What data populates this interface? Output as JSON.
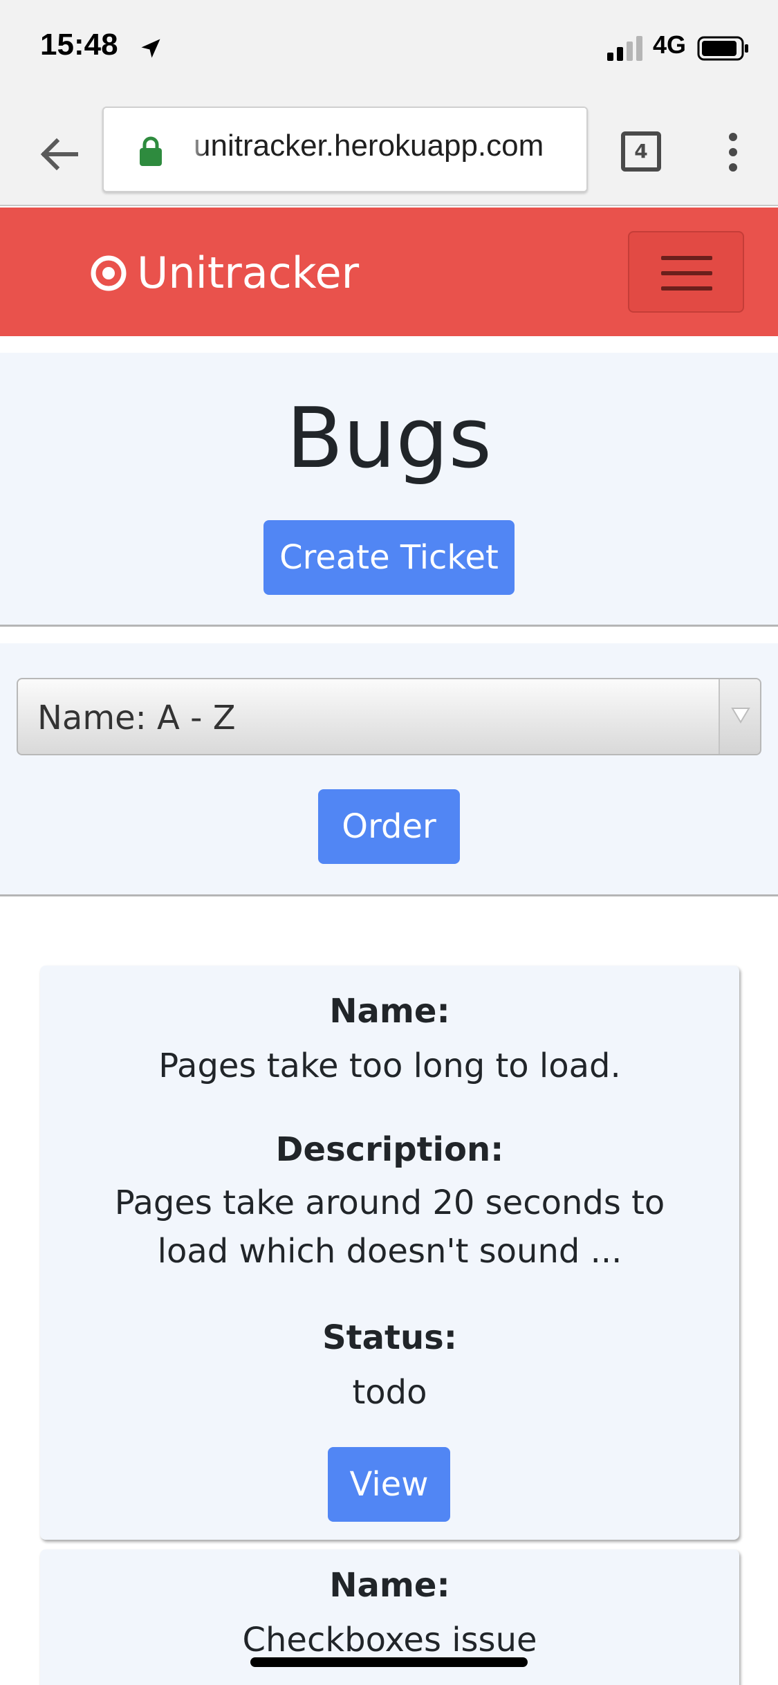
{
  "status_bar": {
    "time": "15:48",
    "network": "4G"
  },
  "browser": {
    "url": "unitracker.herokuapp.com",
    "tab_count": "4"
  },
  "navbar": {
    "brand": "Unitracker",
    "brand_color": "#e9524c"
  },
  "header": {
    "title": "Bugs",
    "create_button": "Create Ticket"
  },
  "sort": {
    "selected": "Name: A - Z",
    "order_button": "Order"
  },
  "tickets": [
    {
      "name_label": "Name:",
      "name": "Pages take too long to load.",
      "description_label": "Description:",
      "description": "Pages take around 20 seconds to load which doesn't sound ...",
      "status_label": "Status:",
      "status": "todo",
      "view_button": "View"
    },
    {
      "name_label": "Name:",
      "name": "Checkboxes issue"
    }
  ],
  "colors": {
    "primary_button": "#5186f4",
    "section_bg": "#f2f6fc"
  }
}
